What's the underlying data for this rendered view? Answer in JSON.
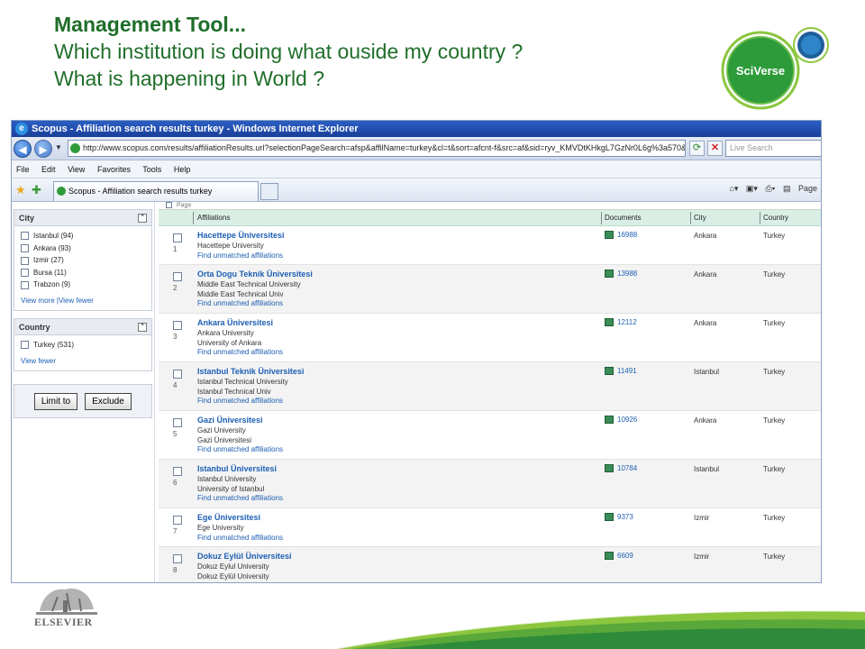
{
  "slide": {
    "title_line1": "Management Tool...",
    "title_line2": "Which institution is doing what ouside my country ?",
    "title_line3": "What is happening in World ?",
    "logo_text": "SciVerse",
    "footer_logo_text": "ELSEVIER"
  },
  "browser": {
    "window_title": "Scopus - Affiliation search results turkey - Windows Internet Explorer",
    "address_url": "http://www.scopus.com/results/affiliationResults.url?selectionPageSearch=afsp&affilName=turkey&cl=t&sort=afcnt-f&src=af&sid=ryv_KMVDtKHkgL7GzNr0L6g%3a570&sot=afs",
    "search_placeholder": "Live Search",
    "menu": [
      "File",
      "Edit",
      "View",
      "Favorites",
      "Tools",
      "Help"
    ],
    "tab_title": "Scopus - Affiliation search results turkey",
    "page_label": "Page"
  },
  "sidebar": {
    "city_panel": {
      "title": "City",
      "items": [
        "Istanbul (94)",
        "Ankara (93)",
        "Izmir (27)",
        "Bursa (11)",
        "Trabzon (9)"
      ],
      "link": "View more |View fewer"
    },
    "country_panel": {
      "title": "Country",
      "items": [
        "Turkey (531)"
      ],
      "link": "View fewer"
    },
    "limit_label": "Limit to",
    "exclude_label": "Exclude"
  },
  "results": {
    "top_label": "Page",
    "columns": {
      "affiliations": "Affiliations",
      "documents": "Documents",
      "city": "City",
      "country": "Country"
    },
    "unmatched_label": "Find unmatched affiliations",
    "rows": [
      {
        "num": "1",
        "name": "Hacettepe Üniversitesi",
        "variants": [
          "Hacettepe University"
        ],
        "docs": "16988",
        "city": "Ankara",
        "country": "Turkey"
      },
      {
        "num": "2",
        "name": "Orta Dogu Teknik Üniversitesi",
        "variants": [
          "Middle East Technical University",
          "Middle East Technical Univ"
        ],
        "docs": "13988",
        "city": "Ankara",
        "country": "Turkey"
      },
      {
        "num": "3",
        "name": "Ankara Üniversitesi",
        "variants": [
          "Ankara University",
          "University of Ankara"
        ],
        "docs": "12112",
        "city": "Ankara",
        "country": "Turkey"
      },
      {
        "num": "4",
        "name": "Istanbul Teknik Üniversitesi",
        "variants": [
          "Istanbul Technical University",
          "Istanbul Technical Univ"
        ],
        "docs": "11491",
        "city": "Istanbul",
        "country": "Turkey"
      },
      {
        "num": "5",
        "name": "Gazi Üniversitesi",
        "variants": [
          "Gazi University",
          "Gazi Üniversitesi"
        ],
        "docs": "10926",
        "city": "Ankara",
        "country": "Turkey"
      },
      {
        "num": "6",
        "name": "Istanbul Üniversitesi",
        "variants": [
          "Istanbul University",
          "University of Istanbul"
        ],
        "docs": "10784",
        "city": "Istanbul",
        "country": "Turkey"
      },
      {
        "num": "7",
        "name": "Ege Üniversitesi",
        "variants": [
          "Ege University"
        ],
        "docs": "9373",
        "city": "Izmir",
        "country": "Turkey"
      },
      {
        "num": "8",
        "name": "Dokuz Eylül Üniversitesi",
        "variants": [
          "Dokuz Eylul University",
          "Dokuz Eylül University"
        ],
        "docs": "6609",
        "city": "Izmir",
        "country": "Turkey"
      }
    ]
  },
  "colors": {
    "title_green": "#1f6e2a",
    "link_blue": "#1d5fb3",
    "header_mint": "#d9efe6",
    "titlebar_blue": "#2b5fc4"
  }
}
